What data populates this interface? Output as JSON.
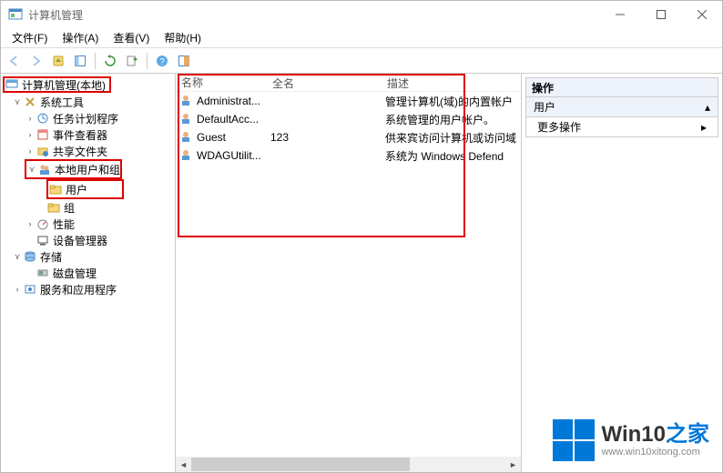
{
  "window": {
    "title": "计算机管理"
  },
  "menu": {
    "file": "文件(F)",
    "action": "操作(A)",
    "view": "查看(V)",
    "help": "帮助(H)"
  },
  "tree": {
    "root": "计算机管理(本地)",
    "n1": "系统工具",
    "n1_1": "任务计划程序",
    "n1_2": "事件查看器",
    "n1_3": "共享文件夹",
    "n1_4": "本地用户和组",
    "n1_4_1": "用户",
    "n1_4_2": "组",
    "n1_5": "性能",
    "n1_6": "设备管理器",
    "n2": "存储",
    "n2_1": "磁盘管理",
    "n3": "服务和应用程序"
  },
  "list": {
    "headers": {
      "name": "名称",
      "fullname": "全名",
      "desc": "描述"
    },
    "rows": [
      {
        "name": "Administrat...",
        "fullname": "",
        "desc": "管理计算机(域)的内置帐户"
      },
      {
        "name": "DefaultAcc...",
        "fullname": "",
        "desc": "系统管理的用户帐户。"
      },
      {
        "name": "Guest",
        "fullname": "123",
        "desc": "供来宾访问计算机或访问域"
      },
      {
        "name": "WDAGUtilit...",
        "fullname": "",
        "desc": "系统为 Windows Defend"
      }
    ]
  },
  "actions": {
    "title": "操作",
    "section": "用户",
    "more": "更多操作"
  },
  "watermark": {
    "t1": "Win10",
    "t2": "之家",
    "url": "www.win10xitong.com"
  }
}
